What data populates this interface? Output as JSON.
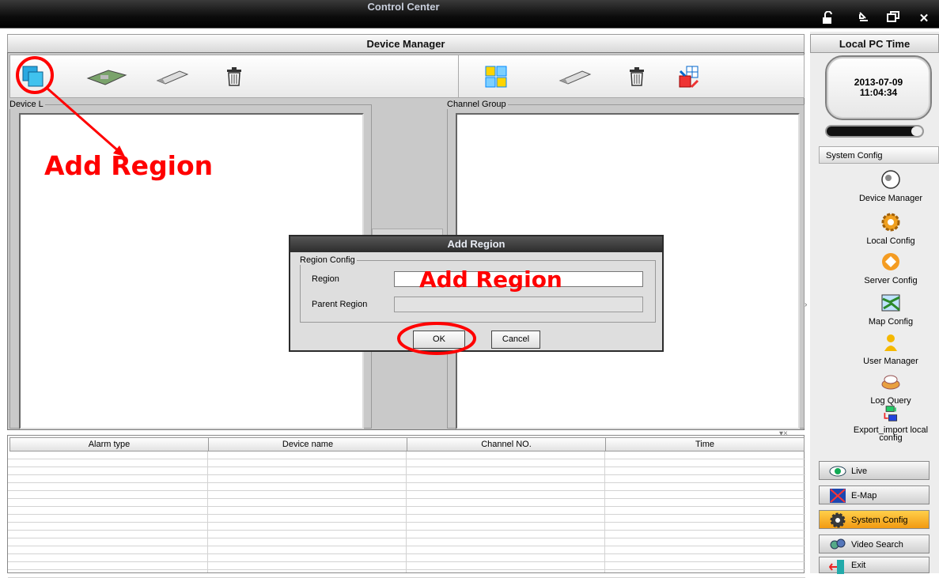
{
  "window": {
    "title": "Control Center",
    "buttons": [
      "lock",
      "minimize",
      "restore",
      "close"
    ]
  },
  "main": {
    "header": "Device Manager",
    "left_toolbar": [
      "add-region-icon",
      "add-device-icon",
      "remove-device-icon",
      "delete-icon"
    ],
    "right_toolbar": [
      "group-icon",
      "remove-channel-icon",
      "delete-icon",
      "import-icon"
    ],
    "device_box_label": "Device L",
    "channel_group_label": "Channel Group"
  },
  "grid": {
    "columns": [
      "Alarm type",
      "Device name",
      "Channel NO.",
      "Time"
    ],
    "close_glyph": "▾×"
  },
  "right_pane": {
    "header": "Local PC Time",
    "date": "2013-07-09",
    "time": "11:04:34",
    "section_header": "System Config",
    "config_items": [
      "Device Manager",
      "Local Config",
      "Server Config",
      "Map Config",
      "User Manager",
      "Log Query",
      "Export_import local config"
    ],
    "nav": [
      {
        "label": "Live"
      },
      {
        "label": "E-Map"
      },
      {
        "label": "System Config",
        "active": true
      },
      {
        "label": "Video Search"
      },
      {
        "label": "Exit"
      }
    ]
  },
  "dialog": {
    "title": "Add Region",
    "group_label": "Region Config",
    "region_label": "Region",
    "region_value": "",
    "parent_label": "Parent Region",
    "parent_value": "",
    "ok": "OK",
    "cancel": "Cancel"
  },
  "annotations": {
    "top_left": "Add Region",
    "dialog": "Add Region",
    "color": "#ff0000"
  }
}
